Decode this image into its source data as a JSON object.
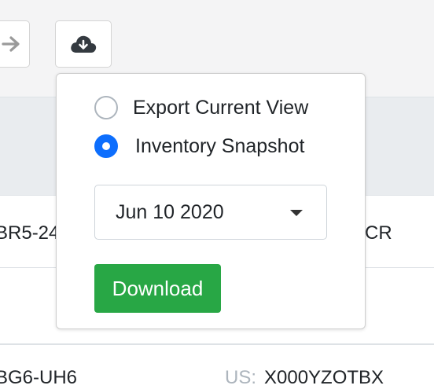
{
  "toolbar": {
    "forward_icon": "arrow-right-icon",
    "download_icon": "cloud-download-icon"
  },
  "table": {
    "row1": {
      "left_text": "BR5-24",
      "right_text": "CR"
    },
    "row2": {
      "left_text": "BG6-UH6",
      "right_prefix": "US:",
      "right_text": "X000YZOTBX"
    }
  },
  "popover": {
    "options": [
      {
        "label": "Export Current View",
        "checked": false
      },
      {
        "label": "Inventory Snapshot",
        "checked": true
      }
    ],
    "date_select": {
      "value": "Jun 10 2020"
    },
    "download_label": "Download"
  },
  "colors": {
    "primary": "#0d6efd",
    "success": "#28a745",
    "toolbar_bg": "#f4f4f5"
  }
}
